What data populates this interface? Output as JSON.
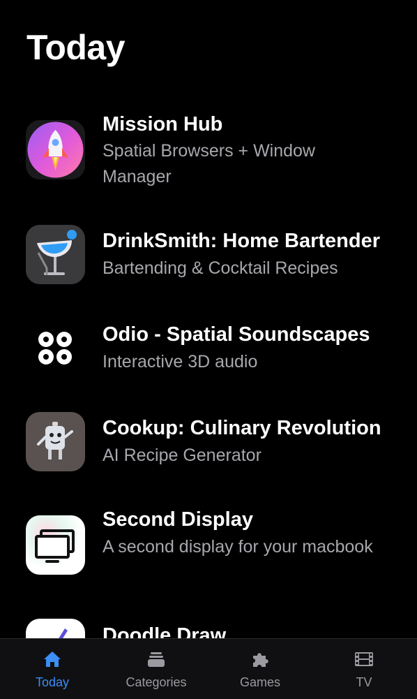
{
  "header": {
    "title": "Today"
  },
  "apps": [
    {
      "name": "Mission Hub",
      "subtitle": "Spatial Browsers + Window Manager",
      "icon": "rocket-icon"
    },
    {
      "name": "DrinkSmith: Home Bartender",
      "subtitle": "Bartending & Cocktail Recipes",
      "icon": "cocktail-glass-icon"
    },
    {
      "name": "Odio - Spatial Soundscapes",
      "subtitle": "Interactive 3D audio",
      "icon": "four-dots-icon"
    },
    {
      "name": "Cookup: Culinary Revolution",
      "subtitle": "AI Recipe Generator",
      "icon": "robot-chef-icon"
    },
    {
      "name": "Second Display",
      "subtitle": "A second display for your macbook",
      "icon": "dual-monitor-icon"
    },
    {
      "name": "Doodle Draw",
      "subtitle": "",
      "icon": "pencil-icon"
    }
  ],
  "tabbar": {
    "tabs": [
      {
        "label": "Today",
        "icon": "house-icon",
        "active": true
      },
      {
        "label": "Categories",
        "icon": "stack-icon",
        "active": false
      },
      {
        "label": "Games",
        "icon": "puzzle-icon",
        "active": false
      },
      {
        "label": "TV",
        "icon": "film-icon",
        "active": false
      }
    ]
  },
  "colors": {
    "accent": "#3b8ff5",
    "background": "#000000",
    "secondary_text": "#a7a7ad"
  }
}
